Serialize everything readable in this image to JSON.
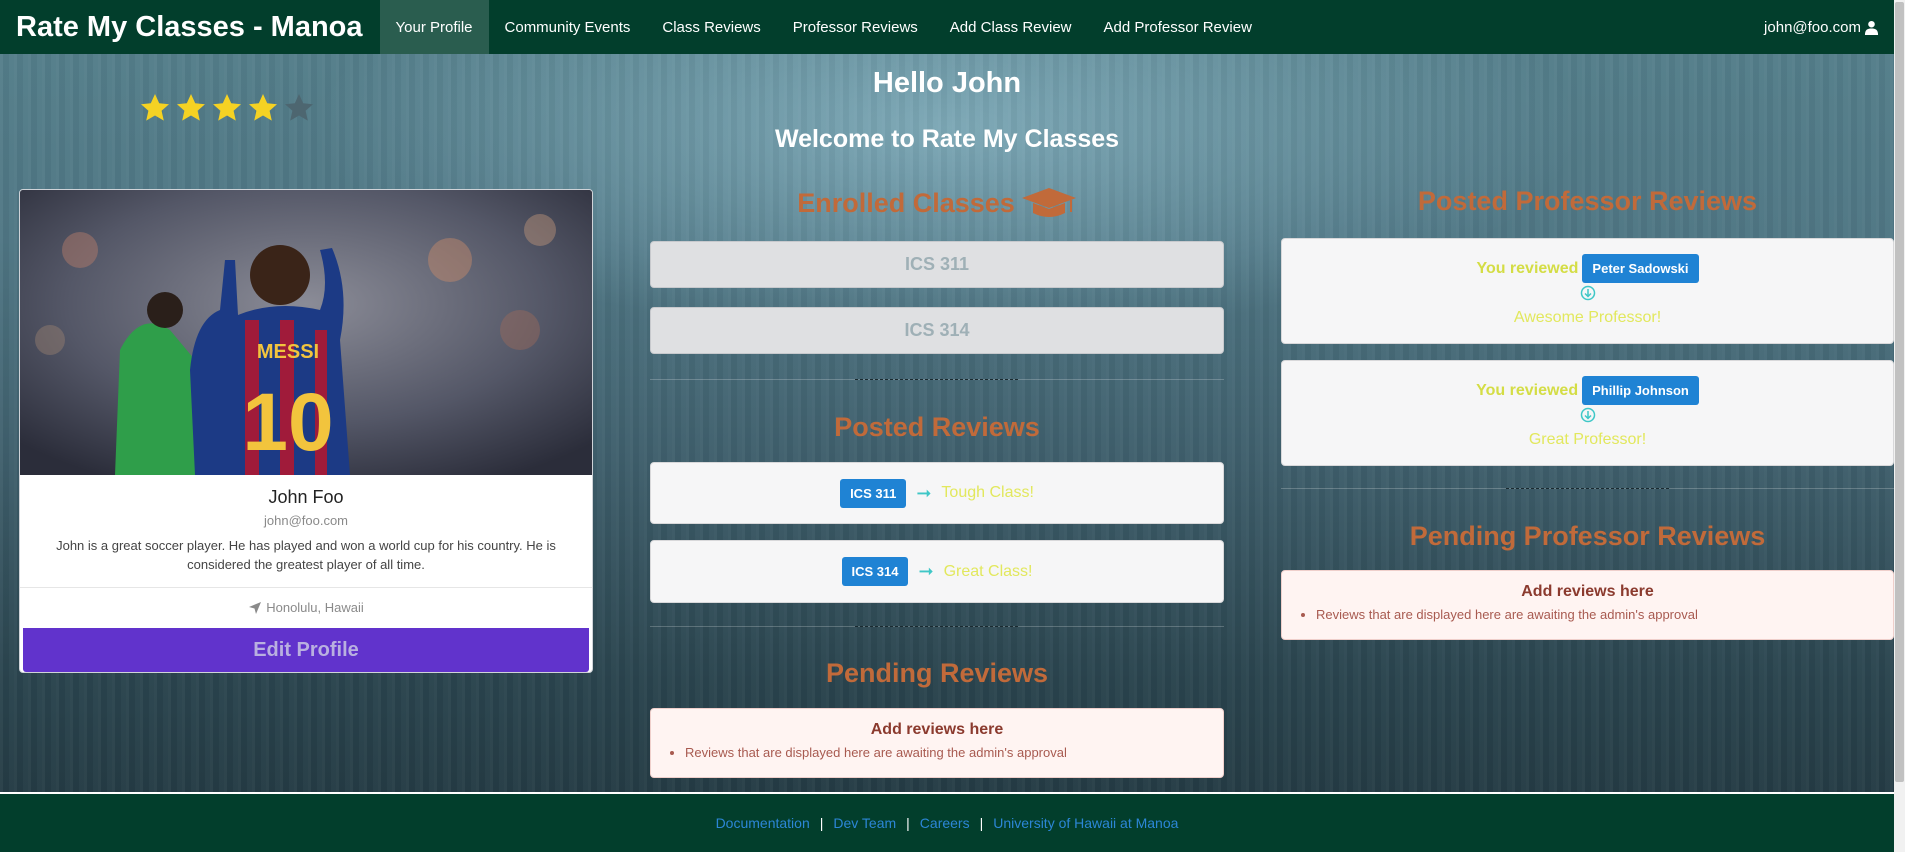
{
  "navbar": {
    "brand": "Rate My Classes - Manoa",
    "items": [
      {
        "label": "Your Profile",
        "active": true
      },
      {
        "label": "Community Events"
      },
      {
        "label": "Class Reviews"
      },
      {
        "label": "Professor Reviews"
      },
      {
        "label": "Add Class Review"
      },
      {
        "label": "Add Professor Review"
      }
    ],
    "user": "john@foo.com",
    "user_icon": "user-icon"
  },
  "rating": {
    "value": 4,
    "max": 5,
    "icon": "star-icon"
  },
  "greeting": "Hello John",
  "welcome": "Welcome to Rate My Classes",
  "profile": {
    "name": "John Foo",
    "email": "john@foo.com",
    "bio": "John is a great soccer player. He has played and won a world cup for his country. He is considered the greatest player of all time.",
    "location": "Honolulu, Hawaii",
    "location_icon": "location-arrow-icon",
    "edit_label": "Edit Profile"
  },
  "enrolled": {
    "title": "Enrolled Classes",
    "icon": "graduation-cap-icon",
    "classes": [
      "ICS 311",
      "ICS 314"
    ]
  },
  "posted_reviews": {
    "title": "Posted Reviews",
    "items": [
      {
        "course": "ICS 311",
        "text": "Tough Class!"
      },
      {
        "course": "ICS 314",
        "text": "Great Class!"
      }
    ]
  },
  "pending_reviews": {
    "title": "Pending Reviews",
    "card_title": "Add reviews here",
    "note": "Reviews that are displayed here are awaiting the admin's approval"
  },
  "posted_prof_reviews": {
    "title": "Posted Professor Reviews",
    "prefix": "You reviewed",
    "items": [
      {
        "professor": "Peter Sadowski",
        "text": "Awesome Professor!"
      },
      {
        "professor": "Phillip Johnson",
        "text": "Great Professor!"
      }
    ]
  },
  "pending_prof_reviews": {
    "title": "Pending Professor Reviews",
    "card_title": "Add reviews here",
    "note": "Reviews that are displayed here are awaiting the admin's approval"
  },
  "footer": {
    "links": [
      "Documentation",
      "Dev Team",
      "Careers",
      "University of Hawaii at Manoa"
    ],
    "separator": "|"
  },
  "colors": {
    "navbar": "#023e2c",
    "accent_orange": "#c16a3a",
    "badge_blue": "#1f83d4",
    "edit_purple": "#6133cc",
    "star_yellow": "#f5d223"
  }
}
